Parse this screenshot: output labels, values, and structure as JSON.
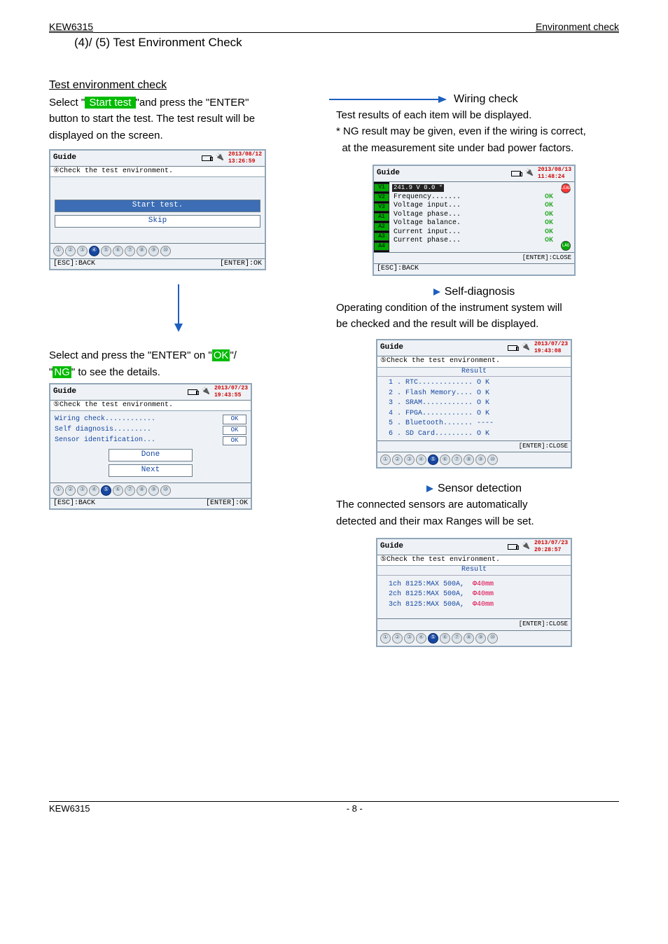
{
  "header": {
    "left": "KEW6315",
    "right": "Environment check"
  },
  "section_title": "(4)/ (5) Test Environment Check",
  "test_env": {
    "heading": "Test environment check",
    "line1a": "Select \"",
    "start_test_hl": " Start test ",
    "line1b": "\"and press the \"ENTER\"",
    "line2": "button to start the test. The test result will be",
    "line3": "displayed on the screen."
  },
  "dev1": {
    "title": "Guide",
    "timestamp": "2013/08/12\n13:26:59",
    "band": "④Check the test environment.",
    "btn_start": "Start test.",
    "btn_skip": "Skip",
    "steps_active": 4,
    "foot_left": "[ESC]:BACK",
    "foot_right": "[ENTER]:OK"
  },
  "midtext": {
    "l1a": "Select and press the \"ENTER\" on \"",
    "ok_hl": "OK",
    "l1b": "\"/",
    "l2a": "\"",
    "ng_hl": "NG",
    "l2b": "\" to see the details."
  },
  "dev2": {
    "title": "Guide",
    "timestamp": "2013/07/23\n19:43:55",
    "band": "⑤Check the test environment.",
    "rows": [
      {
        "label": "Wiring check............",
        "val": "OK"
      },
      {
        "label": "Self diagnosis.........",
        "val": "OK"
      },
      {
        "label": "Sensor identification...",
        "val": "OK"
      }
    ],
    "btn_done": "Done",
    "btn_next": "Next",
    "steps_active": 5,
    "foot_left": "[ESC]:BACK",
    "foot_right": "[ENTER]:OK"
  },
  "wiring": {
    "heading": "Wiring check",
    "t1": "Test results of each item will be displayed.",
    "t2": "* NG result may be given, even if the wiring is correct,",
    "t3": "  at the measurement site under bad power factors.",
    "dev": {
      "title": "Guide",
      "timestamp": "2013/08/13\n11:48:24",
      "topval": "241.9 V   0.0 °",
      "rows": [
        {
          "label": "Frequency.......",
          "val": "OK"
        },
        {
          "label": "Voltage input...",
          "val": "OK"
        },
        {
          "label": "Voltage phase...",
          "val": "OK"
        },
        {
          "label": "Voltage balance.",
          "val": "OK"
        },
        {
          "label": "Current input...",
          "val": "OK"
        },
        {
          "label": "Current phase...",
          "val": "OK"
        }
      ],
      "enter": "[ENTER]:CLOSE",
      "foot": "[ESC]:BACK",
      "left_labels": [
        "V1",
        "V2",
        "V3",
        "A1",
        "A2",
        "A3",
        "A4"
      ],
      "probe_top": "LEAD",
      "probe_bot": "LAG"
    }
  },
  "selfdiag": {
    "heading": "Self-diagnosis",
    "t1": "Operating condition of the instrument system will",
    "t2": "be checked and the result will be displayed.",
    "dev": {
      "title": "Guide",
      "timestamp": "2013/07/23\n19:43:08",
      "band": "⑤Check the test environment.",
      "result_hdr": "Result",
      "rows": [
        "1 . RTC............. O K",
        "2 . Flash Memory.... O K",
        "3 . SRAM............ O K",
        "4 . FPGA............ O K",
        "5 . Bluetooth....... ----",
        "6 . SD Card......... O K"
      ],
      "enter": "[ENTER]:CLOSE",
      "steps_active": 5
    }
  },
  "sensor": {
    "heading": "Sensor detection",
    "t1": "The connected sensors are automatically",
    "t2": "detected and their max Ranges will be set.",
    "dev": {
      "title": "Guide",
      "timestamp": "2013/07/23\n20:28:57",
      "band": "⑤Check the test environment.",
      "result_hdr": "Result",
      "rows": [
        {
          "l": "1ch 8125:MAX 500A,",
          "r": "Φ40mm"
        },
        {
          "l": "2ch 8125:MAX 500A,",
          "r": "Φ40mm"
        },
        {
          "l": "3ch 8125:MAX 500A,",
          "r": "Φ40mm"
        }
      ],
      "enter": "[ENTER]:CLOSE",
      "steps_active": 5
    }
  },
  "footer": {
    "left": "KEW6315",
    "center": "- 8 -"
  }
}
